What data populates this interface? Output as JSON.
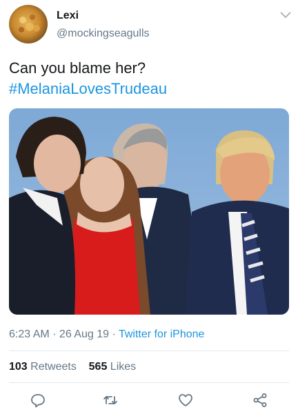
{
  "user": {
    "name": "Lexi",
    "handle": "@mockingseagulls"
  },
  "tweet": {
    "text": "Can you blame her?",
    "hashtag": "#MelaniaLovesTrudeau"
  },
  "meta": {
    "time": "6:23 AM",
    "separator1": " · ",
    "date": "26 Aug 19",
    "separator2": " · ",
    "source": "Twitter for iPhone"
  },
  "stats": {
    "retweets_count": "103",
    "retweets_label": "Retweets",
    "likes_count": "565",
    "likes_label": "Likes"
  },
  "actions": {
    "reply": "reply-icon",
    "retweet": "retweet-icon",
    "like": "heart-icon",
    "share": "share-icon"
  },
  "colors": {
    "accent": "#1b95e0",
    "secondary_text": "#657786",
    "divider": "#e1e8ed"
  }
}
